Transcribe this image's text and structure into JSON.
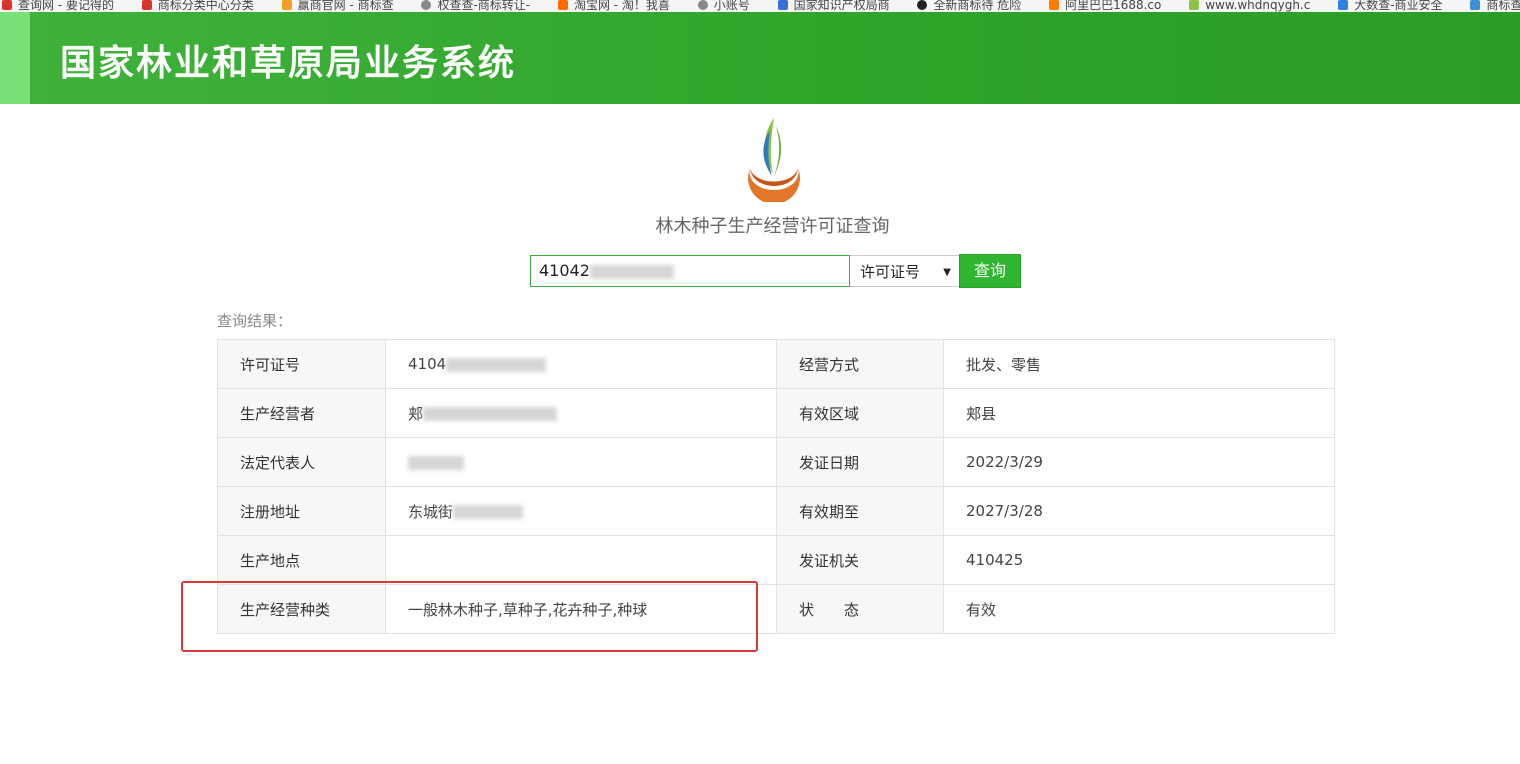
{
  "bookmarks": [
    {
      "label": "查询网 - 要记得的",
      "color": "#d9342b"
    },
    {
      "label": "商标分类中心分类",
      "color": "#d9342b"
    },
    {
      "label": "赢商官网 - 商标查",
      "color": "#f0a020"
    },
    {
      "label": "权查查-商标转让-",
      "color": "#666666"
    },
    {
      "label": "淘宝网 - 淘！我喜",
      "color": "#ff6a00"
    },
    {
      "label": "小账号",
      "color": "#666666"
    },
    {
      "label": "国家知识产权局商",
      "color": "#3a6fd8"
    },
    {
      "label": "全新商标待 危险",
      "color": "#222222"
    },
    {
      "label": "阿里巴巴1688.co",
      "color": "#ff7a00"
    },
    {
      "label": "www.whdnqygh.c",
      "color": "#8bc34a"
    },
    {
      "label": "大数查-商业安全",
      "color": "#2d7fe0"
    },
    {
      "label": "商标查询_国际商标",
      "color": "#3a8fd8"
    }
  ],
  "header": {
    "title": "国家林业和草原局业务系统"
  },
  "page": {
    "subtitle": "林木种子生产经营许可证查询"
  },
  "search": {
    "value_prefix": "41042",
    "select_value": "许可证号",
    "button_label": "查询"
  },
  "results": {
    "label": "查询结果：",
    "rows": [
      {
        "l1": "许可证号",
        "v1": "4104",
        "l2": "经营方式",
        "v2": "批发、零售"
      },
      {
        "l1": "生产经营者",
        "v1": "郏",
        "l2": "有效区域",
        "v2": "郏县"
      },
      {
        "l1": "法定代表人",
        "v1": "",
        "l2": "发证日期",
        "v2": "2022/3/29"
      },
      {
        "l1": "注册地址",
        "v1": "东城街",
        "l2": "有效期至",
        "v2": "2027/3/28"
      },
      {
        "l1": "生产地点",
        "v1": "",
        "l2": "发证机关",
        "v2": "410425"
      },
      {
        "l1": "生产经营种类",
        "v1": "一般林木种子,草种子,花卉种子,种球",
        "l2": "状　　态",
        "v2": "有效"
      }
    ]
  },
  "colors": {
    "header": "#2fa52a",
    "accent": "#2fb52f",
    "highlight": "#d93b3b"
  },
  "icons": {
    "logo": "flame-logo-icon"
  }
}
